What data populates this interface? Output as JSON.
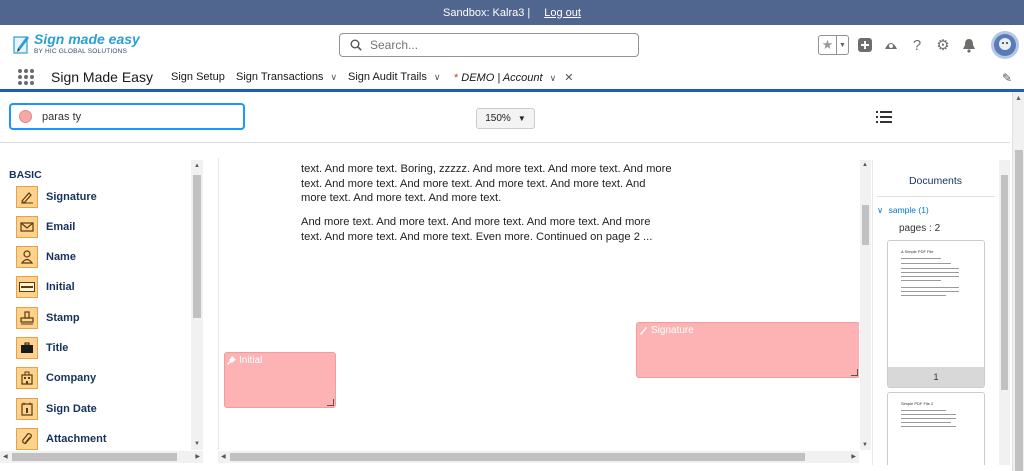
{
  "sandbox_bar": {
    "text": "Sandbox: Kalra3 |",
    "logout": "Log out"
  },
  "logo": {
    "title": "Sign made easy",
    "subtitle": "BY HIC GLOBAL SOLUTIONS"
  },
  "search": {
    "placeholder": "Search..."
  },
  "nav": {
    "app_name": "Sign Made Easy",
    "items": [
      {
        "label": "Sign Setup"
      },
      {
        "label": "Sign Transactions"
      },
      {
        "label": "Sign Audit Trails"
      }
    ],
    "active_tab": {
      "marker": "*",
      "label": "DEMO | Account"
    }
  },
  "toolbar": {
    "signer": {
      "name": "paras ty",
      "color": "#f5a9a9"
    },
    "zoom": "150%"
  },
  "palette": {
    "section": "BASIC",
    "items": [
      {
        "label": "Signature",
        "icon": "signature-pen-icon"
      },
      {
        "label": "Email",
        "icon": "email-icon"
      },
      {
        "label": "Name",
        "icon": "person-icon"
      },
      {
        "label": "Initial",
        "icon": "initial-stamp-icon"
      },
      {
        "label": "Stamp",
        "icon": "stamp-icon"
      },
      {
        "label": "Title",
        "icon": "briefcase-icon"
      },
      {
        "label": "Company",
        "icon": "building-icon"
      },
      {
        "label": "Sign Date",
        "icon": "calendar-icon"
      },
      {
        "label": "Attachment",
        "icon": "paperclip-icon"
      }
    ]
  },
  "document": {
    "paragraph1": "text. And more text. Boring, zzzzz. And more text. And more text. And more text. And more text. And more text. And more text. And more text. And more text. And more text. And more text.",
    "paragraph2": "And more text. And more text. And more text. And more text. And more text. And more text. And more text. Even more. Continued on page 2 ...",
    "fields": [
      {
        "label": "Initial",
        "type": "initial"
      },
      {
        "label": "Signature",
        "type": "signature"
      }
    ]
  },
  "documents_panel": {
    "header": "Documents",
    "doc_name": "sample (1)",
    "pages_label": "pages : 2",
    "thumbnails": [
      {
        "title": "A Simple PDF File",
        "page_number": "1"
      },
      {
        "title": "Simple PDF File 2",
        "page_number": ""
      }
    ]
  },
  "colors": {
    "sandbox_bar": "#51668f",
    "field_fill": "#fdb3b3",
    "accent": "#1b96ff",
    "palette_icon": "#fcd28c"
  }
}
